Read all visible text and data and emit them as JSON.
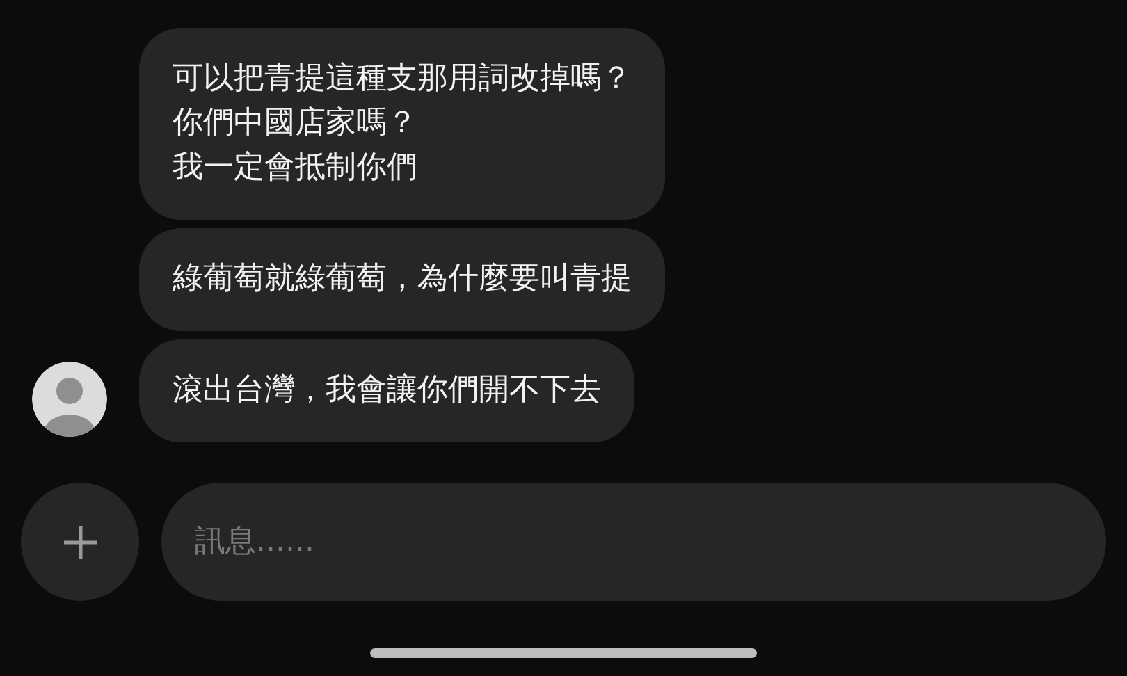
{
  "messages": [
    {
      "lines": [
        "可以把青提這種支那用詞改掉嗎？",
        "你們中國店家嗎？",
        "我一定會抵制你們"
      ],
      "show_avatar": false
    },
    {
      "lines": [
        "綠葡萄就綠葡萄，為什麼要叫青提"
      ],
      "show_avatar": false
    },
    {
      "lines": [
        "滾出台灣，我會讓你們開不下去"
      ],
      "show_avatar": true
    }
  ],
  "composer": {
    "placeholder": "訊息......"
  }
}
